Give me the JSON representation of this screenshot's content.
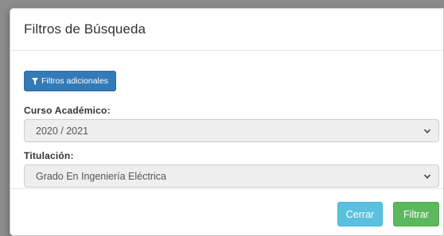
{
  "modal": {
    "title": "Filtros de Búsqueda"
  },
  "filters_button": {
    "label": "Filtros adicionales",
    "icon": "filter-icon"
  },
  "course": {
    "label": "Curso Académico:",
    "selected": "2020 / 2021"
  },
  "degree": {
    "label": "Titulación:",
    "selected": "Grado En Ingeniería Eléctrica"
  },
  "footer": {
    "close_label": "Cerrar",
    "filter_label": "Filtrar"
  },
  "colors": {
    "primary": "#337ab7",
    "info": "#5bc0de",
    "success": "#5cb85c"
  }
}
